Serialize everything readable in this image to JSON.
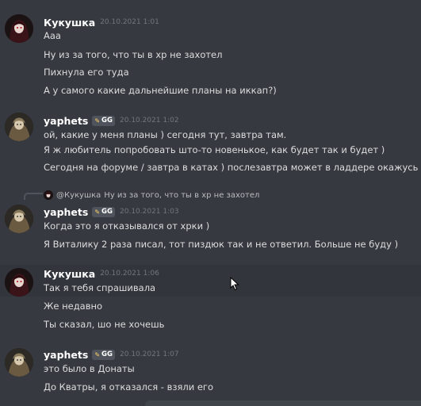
{
  "messages": [
    {
      "author": "Кукушка",
      "timestamp": "20.10.2021 1:01",
      "lines": [
        "Ааа",
        "Ну из за того, что ты в хр не захотел",
        "Пихнула его туда",
        "А у самого какие дальнейшие планы на иккап?)"
      ]
    },
    {
      "author": "yaphets",
      "tag": "GG",
      "timestamp": "20.10.2021 1:02",
      "lines": [
        "ой, какие у меня планы ) сегодня тут, завтра там.",
        "Я ж любитель попробовать што-то новенькое, как будет так и будет )",
        "Сегодня на форуме / завтра в катах ) послезавтра может в ладдере окажусь"
      ]
    },
    {
      "reply_to": {
        "author": "@Кукушка",
        "text": "Ну из за того, что ты в хр не захотел"
      },
      "author": "yaphets",
      "tag": "GG",
      "timestamp": "20.10.2021 1:03",
      "lines": [
        "Когда это я отказывался от хрки )",
        "Я Виталику 2 раза писал, тот пиздюк так и не ответил. Больше не буду )"
      ]
    },
    {
      "author": "Кукушка",
      "timestamp": "20.10.2021 1:06",
      "lines": [
        "Так я тебя спрашивала",
        "Же недавно",
        "Ты сказал, шо не хочешь"
      ]
    },
    {
      "author": "yaphets",
      "tag": "GG",
      "timestamp": "20.10.2021 1:07",
      "lines": [
        "это было в Донаты",
        "До Кватры, я отказался - взяли его"
      ]
    }
  ]
}
